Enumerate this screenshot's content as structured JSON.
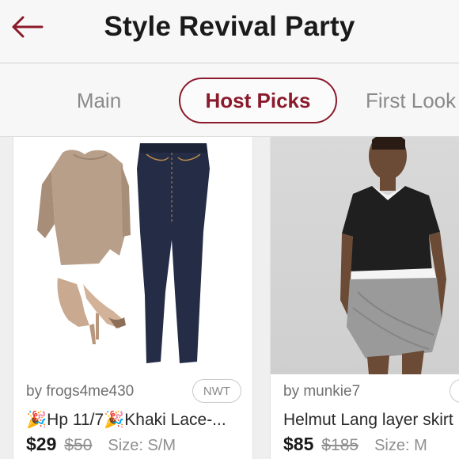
{
  "header": {
    "title": "Style Revival Party",
    "back_icon": "back-arrow-icon",
    "accent_color": "#8b1a2b"
  },
  "tabs": [
    {
      "label": "Main",
      "selected": false
    },
    {
      "label": "Host Picks",
      "selected": true
    },
    {
      "label": "First Look",
      "selected": false
    }
  ],
  "listings": [
    {
      "seller": "by frogs4me430",
      "badge": "NWT",
      "title": "🎉Hp 11/7🎉Khaki Lace-...",
      "price": "$29",
      "original_price": "$50",
      "size": "Size: S/M"
    },
    {
      "seller": "by munkie7",
      "badge": "",
      "title": "Helmut Lang layer skirt",
      "price": "$85",
      "original_price": "$185",
      "size": "Size: M"
    }
  ]
}
